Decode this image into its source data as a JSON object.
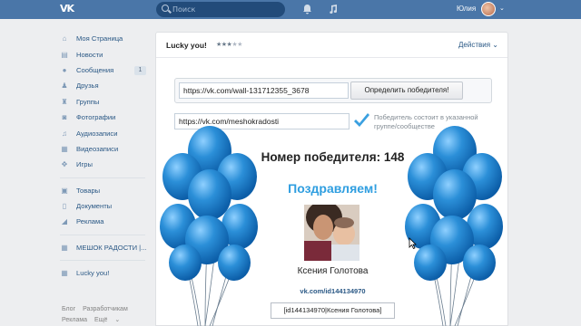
{
  "topbar": {
    "logo": "VK",
    "search_placeholder": "Поиск",
    "username": "Юлия",
    "icons": [
      "bell-icon",
      "music-icon"
    ]
  },
  "sidebar": {
    "items": [
      {
        "label": "Моя Страница",
        "icon": "home-icon"
      },
      {
        "label": "Новости",
        "icon": "news-icon"
      },
      {
        "label": "Сообщения",
        "icon": "messages-icon",
        "count": "1"
      },
      {
        "label": "Друзья",
        "icon": "friends-icon"
      },
      {
        "label": "Группы",
        "icon": "groups-icon"
      },
      {
        "label": "Фотографии",
        "icon": "photos-icon"
      },
      {
        "label": "Аудиозаписи",
        "icon": "audio-icon"
      },
      {
        "label": "Видеозаписи",
        "icon": "video-icon"
      },
      {
        "label": "Игры",
        "icon": "games-icon"
      }
    ],
    "items2": [
      {
        "label": "Товары",
        "icon": "goods-icon"
      },
      {
        "label": "Документы",
        "icon": "documents-icon"
      },
      {
        "label": "Реклама",
        "icon": "ads-icon"
      }
    ],
    "group": {
      "label": "МЕШОК РАДОСТИ |...",
      "icon": "group-app-icon"
    },
    "app": {
      "label": "Lucky you!",
      "icon": "app-icon"
    },
    "footer": [
      "Блог",
      "Разработчикам",
      "Реклама",
      "Ещё"
    ]
  },
  "app": {
    "title": "Lucky you!",
    "rating": 3,
    "actions_label": "Действия",
    "wall_url": "https://vk.com/wall-131712355_3678",
    "determine_button": "Определить победителя!",
    "group_url": "https://vk.com/meshokradosti",
    "check_text": "Победитель состоит в указанной группе/сообществе",
    "winner_number": "Номер победителя: 148",
    "congrats": "Поздравляем!",
    "winner_name": "Ксения Голотова",
    "winner_link": "vk.com/id144134970",
    "mention": "[id144134970|Ксения Голотова]"
  },
  "colors": {
    "topbar": "#4a76a8",
    "link": "#2a5885",
    "congrats": "#2f9ee0",
    "balloon": "#2b8fd8"
  }
}
